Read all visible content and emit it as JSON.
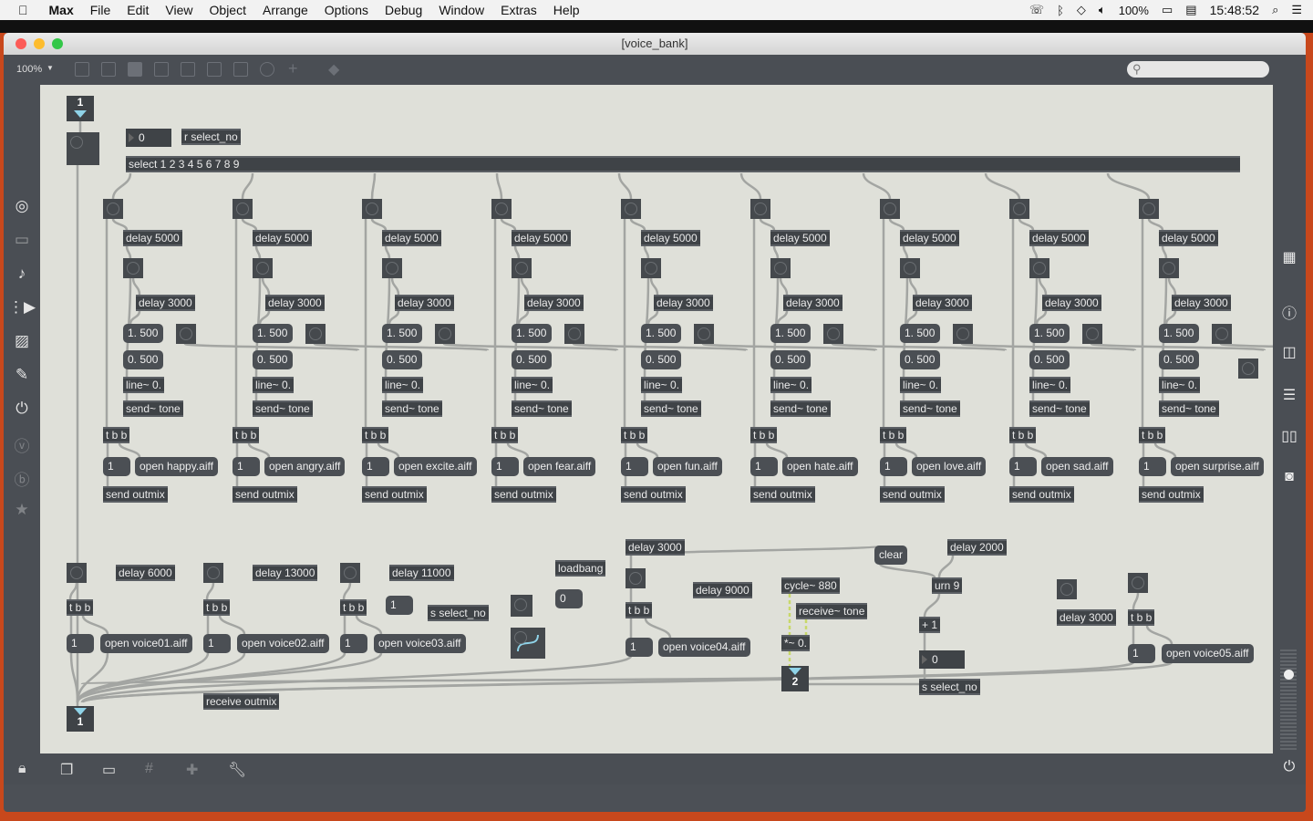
{
  "menubar": {
    "app": "Max",
    "items": [
      "File",
      "Edit",
      "View",
      "Object",
      "Arrange",
      "Options",
      "Debug",
      "Window",
      "Extras",
      "Help"
    ],
    "battery": "100%",
    "clock": "15:48:52"
  },
  "window": {
    "title": "[voice_bank]",
    "zoom": "100%"
  },
  "search": {
    "placeholder": ""
  },
  "top": {
    "inlet": "1",
    "number": "0",
    "receive": "r select_no",
    "select": "select 1 2 3 4 5 6 7 8 9"
  },
  "column_common": {
    "delay1": "delay 5000",
    "delay2": "delay 3000",
    "msg_a": "1. 500",
    "msg_b": "0. 500",
    "line": "line~ 0.",
    "send_tone": "send~ tone",
    "trigger": "t b b",
    "one": "1",
    "send_outmix": "send outmix"
  },
  "columns": [
    {
      "open": "open happy.aiff"
    },
    {
      "open": "open angry.aiff"
    },
    {
      "open": "open excite.aiff"
    },
    {
      "open": "open fear.aiff"
    },
    {
      "open": "open fun.aiff"
    },
    {
      "open": "open hate.aiff"
    },
    {
      "open": "open love.aiff"
    },
    {
      "open": "open sad.aiff"
    },
    {
      "open": "open surprise.aiff"
    }
  ],
  "voices": [
    {
      "delay": "delay 6000",
      "trigger": "t b b",
      "one": "1",
      "open": "open voice01.aiff"
    },
    {
      "delay": "delay 13000",
      "trigger": "t b b",
      "one": "1",
      "open": "open voice02.aiff"
    },
    {
      "delay": "delay 11000",
      "trigger": "t b b",
      "one": "1",
      "open": "open voice03.aiff"
    }
  ],
  "misc": {
    "one_msg": "1",
    "send_select": "s select_no",
    "loadbang": "loadbang",
    "zero_msg": "0",
    "v4_delay": "delay 3000",
    "v4_delay2": "delay 9000",
    "v4_trigger": "t b b",
    "v4_one": "1",
    "v4_open": "open voice04.aiff",
    "cycle": "cycle~ 880",
    "receive_tone": "receive~ tone",
    "mult": "*~ 0.",
    "outlet2": "2",
    "clear": "clear",
    "delay2000": "delay 2000",
    "urn": "urn 9",
    "plus1": "+ 1",
    "number0": "0",
    "send_select2": "s select_no",
    "v5_delay": "delay 3000",
    "v5_trigger": "t b b",
    "v5_one": "1",
    "v5_open": "open voice05.aiff",
    "receive_outmix": "receive outmix",
    "outlet1": "1"
  },
  "icons": {
    "left": [
      "target-icon",
      "browser-icon",
      "music-note-icon",
      "video-icon",
      "image-icon",
      "paperclip-icon",
      "plug-icon",
      "v-icon",
      "b-icon",
      "star-icon"
    ],
    "right": [
      "grid-icon",
      "info-icon",
      "columns-icon",
      "list-icon",
      "book-icon",
      "camera-icon",
      "power-icon"
    ],
    "bottom": [
      "lock-icon",
      "windows-icon",
      "presentation-icon",
      "grid-icon",
      "add-icon",
      "wrench-icon"
    ]
  },
  "colors": {
    "canvas": "#dfe0d9",
    "object": "#3f4347",
    "message": "#4b4f54",
    "cord": "#a3a5a2",
    "signal_cord": "#c8d86a"
  }
}
